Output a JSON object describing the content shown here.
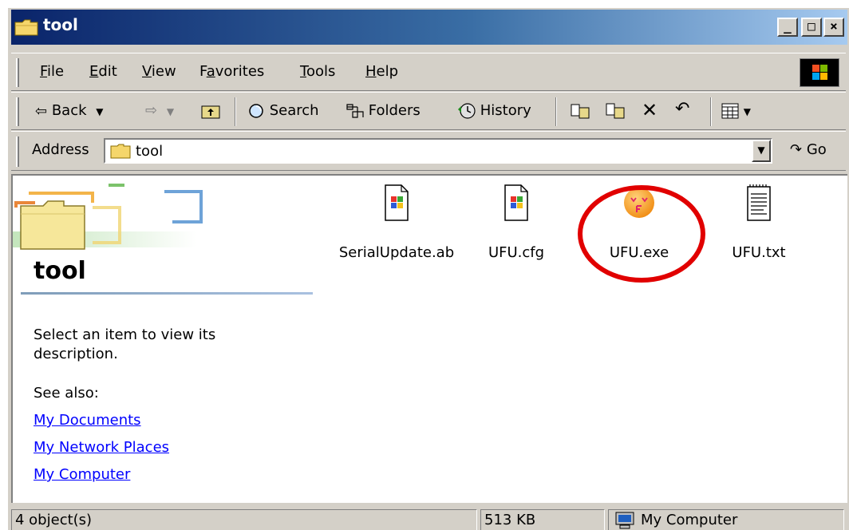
{
  "window": {
    "title": "tool"
  },
  "menu": {
    "items": [
      "File",
      "Edit",
      "View",
      "Favorites",
      "Tools",
      "Help"
    ],
    "mnemonics": [
      "F",
      "E",
      "V",
      "a",
      "T",
      "H"
    ]
  },
  "toolbar": {
    "back": "Back",
    "search": "Search",
    "folders": "Folders",
    "history": "History"
  },
  "address": {
    "label": "Address",
    "value": "tool",
    "go": "Go"
  },
  "leftpane": {
    "title": "tool",
    "description": "Select an item to view its description.",
    "see_also": "See also:",
    "links": [
      "My Documents",
      "My Network Places",
      "My Computer"
    ]
  },
  "files": [
    {
      "name": "SerialUpdate.ab",
      "icon": "windows-file-icon"
    },
    {
      "name": "UFU.cfg",
      "icon": "windows-file-icon"
    },
    {
      "name": "UFU.exe",
      "icon": "ufu-app-icon"
    },
    {
      "name": "UFU.txt",
      "icon": "notepad-text-icon"
    }
  ],
  "status": {
    "objects": "4 object(s)",
    "size": "513 KB",
    "zone": "My Computer"
  },
  "colors": {
    "highlight": "#e10000",
    "titlebar": "#0a246a",
    "link": "#0000ff"
  }
}
